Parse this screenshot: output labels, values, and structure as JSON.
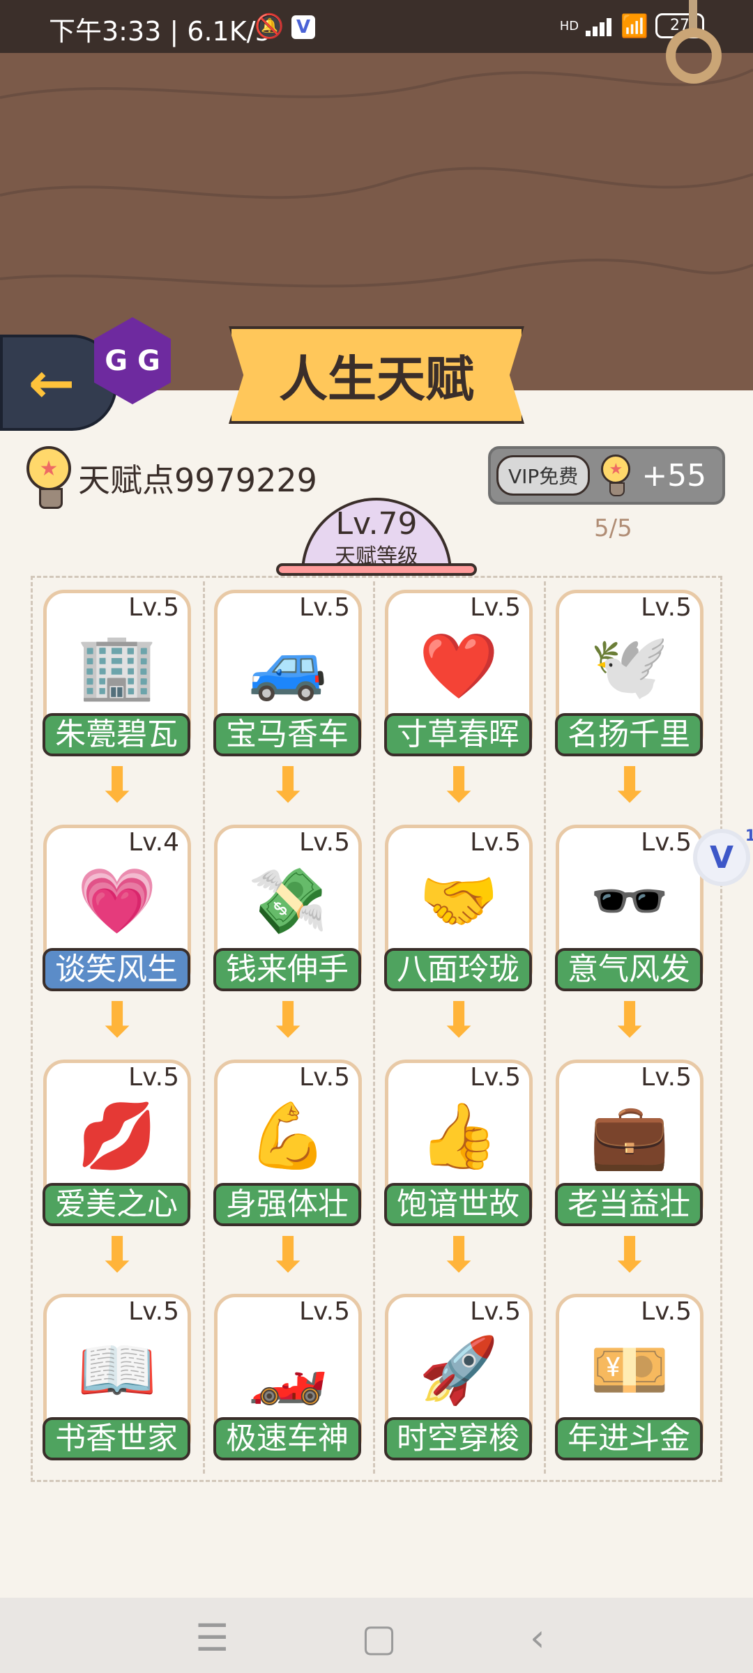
{
  "status_bar": {
    "time_speed": "下午3:33 | 6.1K/s",
    "network": "HD",
    "battery": "27"
  },
  "header": {
    "title": "人生天赋",
    "gg_label": "G G"
  },
  "talent_points": {
    "text": "天赋点9979229"
  },
  "vip": {
    "badge": "VIP免费",
    "amount": "+55",
    "count": "5/5"
  },
  "level": {
    "value": "Lv.79",
    "label": "天赋等级"
  },
  "grid": {
    "rows": [
      [
        {
          "level": "Lv.5",
          "name": "朱甍碧瓦",
          "icon": "sale-building-icon"
        },
        {
          "level": "Lv.5",
          "name": "宝马香车",
          "icon": "sale-car-icon"
        },
        {
          "level": "Lv.5",
          "name": "寸草春晖",
          "icon": "heart-family-icon"
        },
        {
          "level": "Lv.5",
          "name": "名扬千里",
          "icon": "bird-icon"
        }
      ],
      [
        {
          "level": "Lv.4",
          "name": "谈笑风生",
          "icon": "smile-heart-icon"
        },
        {
          "level": "Lv.5",
          "name": "钱来伸手",
          "icon": "money-hand-icon"
        },
        {
          "level": "Lv.5",
          "name": "八面玲珑",
          "icon": "handshake-icon"
        },
        {
          "level": "Lv.5",
          "name": "意气风发",
          "icon": "hat-sunglasses-icon"
        }
      ],
      [
        {
          "level": "Lv.5",
          "name": "爱美之心",
          "icon": "lips-syringe-icon"
        },
        {
          "level": "Lv.5",
          "name": "身强体壮",
          "icon": "muscle-icon"
        },
        {
          "level": "Lv.5",
          "name": "饱谙世故",
          "icon": "thumbs-up-icon"
        },
        {
          "level": "Lv.5",
          "name": "老当益壮",
          "icon": "briefcase-icon"
        }
      ],
      [
        {
          "level": "Lv.5",
          "name": "书香世家",
          "icon": "book-icon"
        },
        {
          "level": "Lv.5",
          "name": "极速车神",
          "icon": "sports-car-icon"
        },
        {
          "level": "Lv.5",
          "name": "时空穿梭",
          "icon": "rocket-icon"
        },
        {
          "level": "Lv.5",
          "name": "年进斗金",
          "icon": "money-growth-icon"
        }
      ]
    ]
  },
  "floating_badge": {
    "label": "V",
    "count": "1"
  },
  "nav": {
    "menu": "☰",
    "home": "▢",
    "back": "‹"
  }
}
